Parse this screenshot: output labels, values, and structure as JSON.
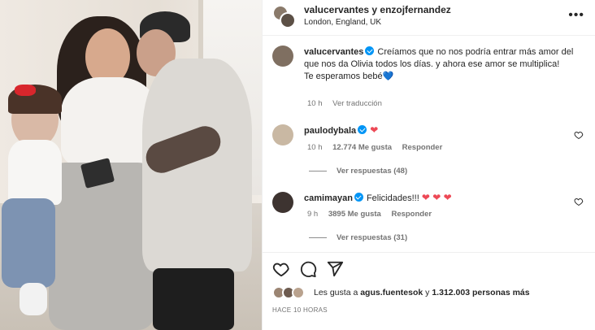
{
  "post": {
    "header": {
      "title": "valucervantes y enzojfernandez",
      "location": "London, England, UK",
      "more_label": "•••"
    },
    "caption": {
      "username": "valucervantes",
      "text": "Creíamos que no nos podría entrar más amor del que nos da Olivia todos los días. y ahora ese amor se multiplica!",
      "line2": "Te esperamos bebé",
      "emoji": "💙",
      "time": "10 h",
      "translate": "Ver traducción"
    },
    "comments": [
      {
        "username": "paulodybala",
        "text": "",
        "emoji": "❤",
        "time": "10 h",
        "likes": "12.774 Me gusta",
        "reply": "Responder",
        "view_replies": "Ver respuestas (48)"
      },
      {
        "username": "camimayan",
        "text": "Felicidades!!!",
        "emoji": "❤ ❤ ❤",
        "time": "9 h",
        "likes": "3895 Me gusta",
        "reply": "Responder",
        "view_replies": "Ver respuestas (31)"
      }
    ],
    "likes": {
      "prefix": "Les gusta a ",
      "user": "agus.fuentesok",
      "middle": " y ",
      "count": "1.312.003 personas más"
    },
    "time_ago": "HACE 10 HORAS"
  },
  "icons": [
    "heart-icon",
    "comment-icon",
    "share-icon",
    "more-icon",
    "verified-icon"
  ],
  "colors": {
    "verified": "#0095f6",
    "heart_red": "#ed4956",
    "heart_blue": "#3897f0",
    "meta_gray": "#737373"
  }
}
